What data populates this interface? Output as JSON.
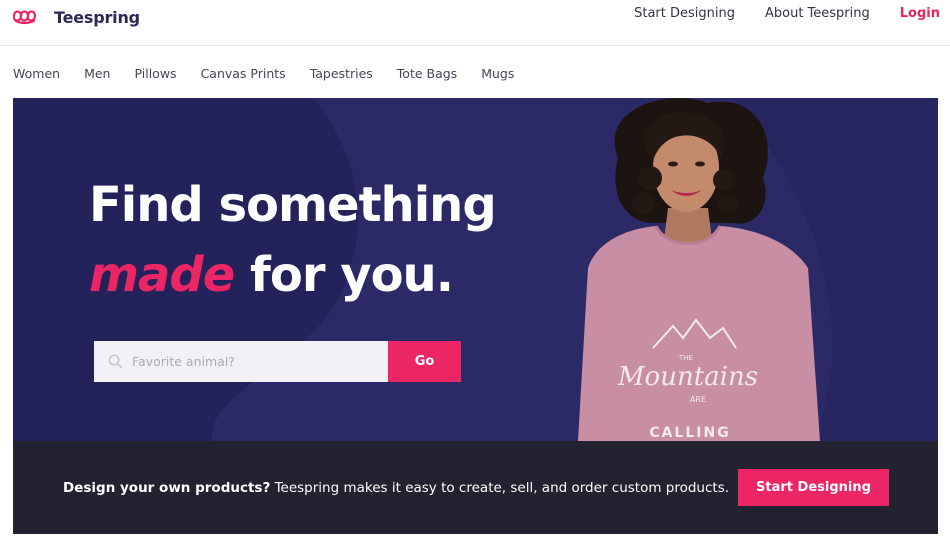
{
  "brand": {
    "name": "Teespring",
    "accent_color": "#ec2565",
    "navy_color": "#2b2a67"
  },
  "header": {
    "links": [
      {
        "label": "Start Designing"
      },
      {
        "label": "About Teespring"
      },
      {
        "label": "Login"
      }
    ]
  },
  "categories": [
    "Women",
    "Men",
    "Pillows",
    "Canvas Prints",
    "Tapestries",
    "Tote Bags",
    "Mugs"
  ],
  "hero": {
    "headline_line1": "Find something",
    "headline_accent": "made",
    "headline_rest": " for you.",
    "search": {
      "placeholder": "Favorite animal?",
      "value": "",
      "icon": "search-icon"
    },
    "go_label": "Go",
    "shirt_print": {
      "line1": "THE",
      "line2": "Mountains",
      "line3": "ARE",
      "line4": "CALLING"
    }
  },
  "banner": {
    "bold_text": "Design your own products?",
    "text": " Teespring makes it easy to create, sell, and order custom products.",
    "button_label": "Start Designing"
  }
}
